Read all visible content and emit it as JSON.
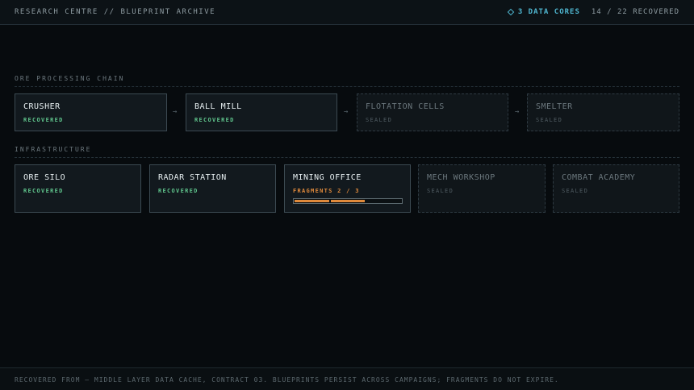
{
  "header": {
    "title": "RESEARCH CENTRE // BLUEPRINT ARCHIVE",
    "data_cores": "3 DATA CORES",
    "recovered_count": "14 / 22 RECOVERED"
  },
  "sections": [
    {
      "label": "ORE PROCESSING CHAIN",
      "cards": [
        {
          "name": "CRUSHER",
          "status": "RECOVERED",
          "state": "recovered"
        },
        {
          "name": "BALL MILL",
          "status": "RECOVERED",
          "state": "recovered"
        },
        {
          "name": "FLOTATION CELLS",
          "status": "SEALED",
          "state": "sealed"
        },
        {
          "name": "SMELTER",
          "status": "SEALED",
          "state": "sealed"
        }
      ]
    },
    {
      "label": "INFRASTRUCTURE",
      "cards": [
        {
          "name": "ORE SILO",
          "status": "RECOVERED",
          "state": "recovered"
        },
        {
          "name": "RADAR STATION",
          "status": "RECOVERED",
          "state": "recovered"
        },
        {
          "name": "MINING OFFICE",
          "status": "FRAGMENTS 2 / 3",
          "state": "fragments",
          "fragments_collected": 2,
          "fragments_total": 3
        },
        {
          "name": "MECH WORKSHOP",
          "status": "SEALED",
          "state": "sealed"
        },
        {
          "name": "COMBAT ACADEMY",
          "status": "SEALED",
          "state": "sealed"
        }
      ]
    }
  ],
  "footer": {
    "text": "RECOVERED FROM — MIDDLE LAYER DATA CACHE, CONTRACT 03. BLUEPRINTS PERSIST ACROSS CAMPAIGNS; FRAGMENTS DO NOT EXPIRE."
  },
  "colors": {
    "accent": "#4fb6d0",
    "recovered": "#5fc48c",
    "fragments": "#e08a3c",
    "sealed": "#505c62"
  },
  "icons": {
    "data_core": "diamond-icon",
    "chain_link": "arrow-right-icon"
  }
}
